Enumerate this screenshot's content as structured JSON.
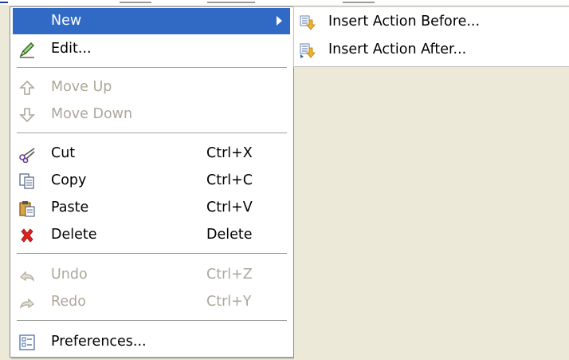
{
  "context_menu": {
    "items": [
      {
        "label": "New",
        "shortcut": "",
        "icon": "new-icon",
        "state": "selected",
        "has_submenu": true
      },
      {
        "label": "Edit...",
        "shortcut": "",
        "icon": "pencil-icon",
        "state": "enabled"
      },
      {
        "label": "Move Up",
        "shortcut": "",
        "icon": "arrow-up-icon",
        "state": "disabled"
      },
      {
        "label": "Move Down",
        "shortcut": "",
        "icon": "arrow-down-icon",
        "state": "disabled"
      },
      {
        "label": "Cut",
        "shortcut": "Ctrl+X",
        "icon": "scissors-icon",
        "state": "enabled"
      },
      {
        "label": "Copy",
        "shortcut": "Ctrl+C",
        "icon": "copy-icon",
        "state": "enabled"
      },
      {
        "label": "Paste",
        "shortcut": "Ctrl+V",
        "icon": "paste-icon",
        "state": "enabled"
      },
      {
        "label": "Delete",
        "shortcut": "Delete",
        "icon": "delete-icon",
        "state": "enabled"
      },
      {
        "label": "Undo",
        "shortcut": "Ctrl+Z",
        "icon": "undo-icon",
        "state": "disabled"
      },
      {
        "label": "Redo",
        "shortcut": "Ctrl+Y",
        "icon": "redo-icon",
        "state": "disabled"
      },
      {
        "label": "Preferences...",
        "shortcut": "",
        "icon": "preferences-icon",
        "state": "enabled"
      }
    ]
  },
  "submenu": {
    "items": [
      {
        "label": "Insert Action Before...",
        "icon": "insert-action-before-icon"
      },
      {
        "label": "Insert Action After...",
        "icon": "insert-action-after-icon"
      }
    ]
  },
  "colors": {
    "selection": "#316ac5",
    "disabled_text": "#aca899",
    "delete_red": "#e02020",
    "background": "#ece9d8"
  }
}
